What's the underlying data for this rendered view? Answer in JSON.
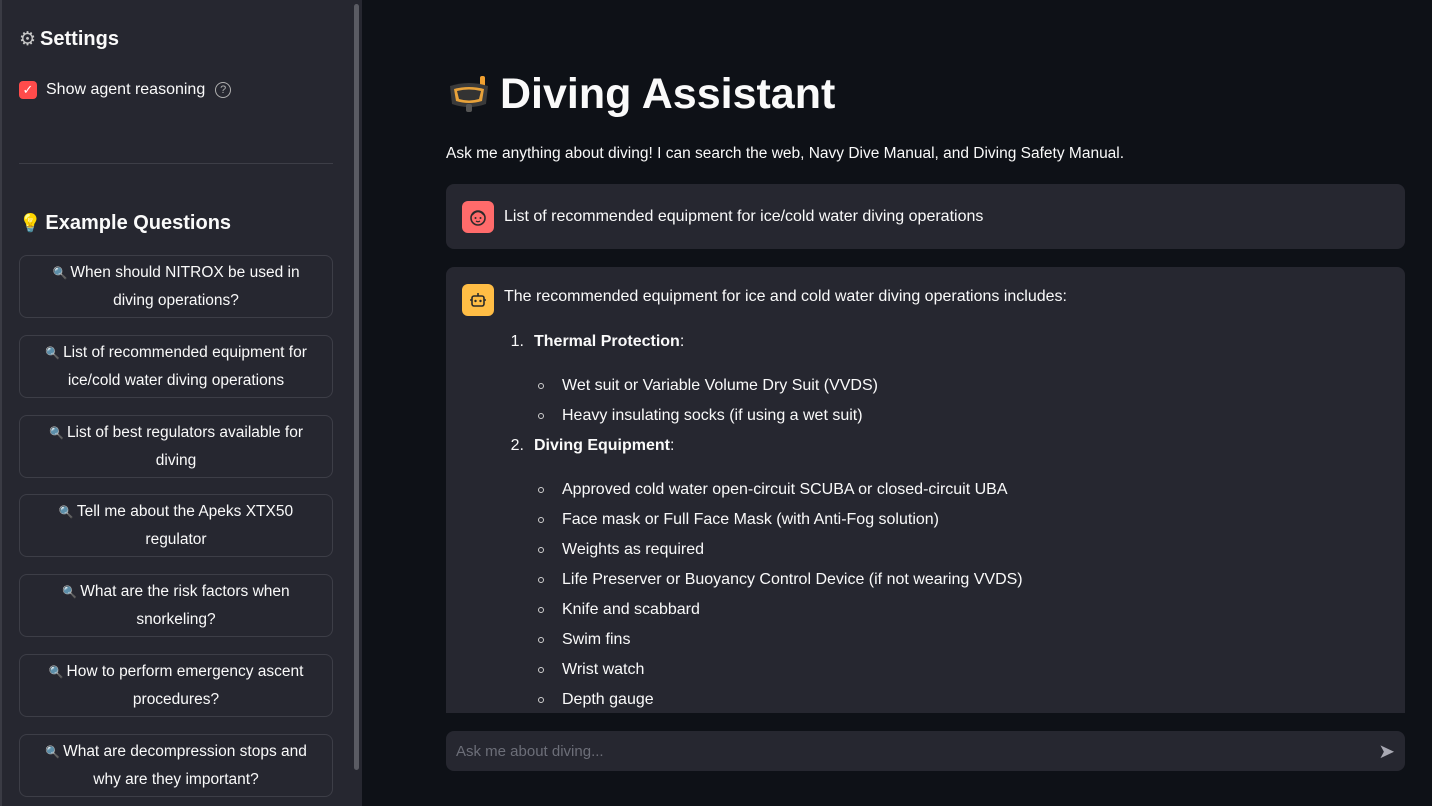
{
  "sidebar": {
    "settings_heading": "Settings",
    "checkbox_label": "Show agent reasoning",
    "checkbox_checked": true,
    "examples_heading": "Example Questions",
    "questions": [
      "When should NITROX be used in diving operations?",
      "List of recommended equipment for ice/cold water diving operations",
      "List of best regulators available for diving",
      "Tell me about the Apeks XTX50 regulator",
      "What are the risk factors when snorkeling?",
      "How to perform emergency ascent procedures?",
      "What are decompression stops and why are they important?"
    ]
  },
  "main": {
    "title": "Diving Assistant",
    "subtitle": "Ask me anything about diving! I can search the web, Navy Dive Manual, and Diving Safety Manual.",
    "user_message": "List of recommended equipment for ice/cold water diving operations",
    "assistant_intro": "The recommended equipment for ice and cold water diving operations includes:",
    "sections": [
      {
        "number": "1.",
        "label": "Thermal Protection",
        "items": [
          "Wet suit or Variable Volume Dry Suit (VVDS)",
          "Heavy insulating socks (if using a wet suit)"
        ]
      },
      {
        "number": "2.",
        "label": "Diving Equipment",
        "items": [
          "Approved cold water open-circuit SCUBA or closed-circuit UBA",
          "Face mask or Full Face Mask (with Anti-Fog solution)",
          "Weights as required",
          "Life Preserver or Buoyancy Control Device (if not wearing VVDS)",
          "Knife and scabbard",
          "Swim fins",
          "Wrist watch",
          "Depth gauge"
        ]
      }
    ],
    "input_placeholder": "Ask me about diving..."
  },
  "colors": {
    "background": "#0e1117",
    "sidebar": "#262730",
    "accent": "#ff4b4b",
    "user_avatar": "#ff6b6b",
    "assistant_avatar": "#ffbd45"
  }
}
